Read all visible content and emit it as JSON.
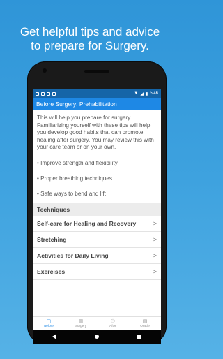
{
  "promo": {
    "line1": "Get helpful tips and advice",
    "line2": "to prepare for Surgery."
  },
  "status": {
    "time": "5:46"
  },
  "appbar": {
    "title": "Before Surgery: Prehabilitation"
  },
  "intro": "This will help you prepare for surgery. Familiarizing yourself with these tips will help you develop good habits that can promote healing after surgery. You may review this with your care team or on your own.",
  "bullets": [
    "• Improve strength and flexibility",
    "• Proper breathing techniques",
    "• Safe ways to bend and lift"
  ],
  "section": "Techniques",
  "rows": [
    "Self-care for Healing and Recovery",
    "Stretching",
    "Activities for Daily Living",
    "Exercises"
  ],
  "chevron": ">",
  "tabs": [
    {
      "label": "Before",
      "icon": "clipboard-icon",
      "active": true
    },
    {
      "label": "Surgery",
      "icon": "bed-icon",
      "active": false
    },
    {
      "label": "After",
      "icon": "walking-icon",
      "active": false
    },
    {
      "label": "Oracle",
      "icon": "document-icon",
      "active": false
    }
  ],
  "colors": {
    "background": "#2f95d8",
    "appbar": "#1e88e5",
    "statusbar": "#1565a8",
    "active_tab": "#1e88e5"
  }
}
